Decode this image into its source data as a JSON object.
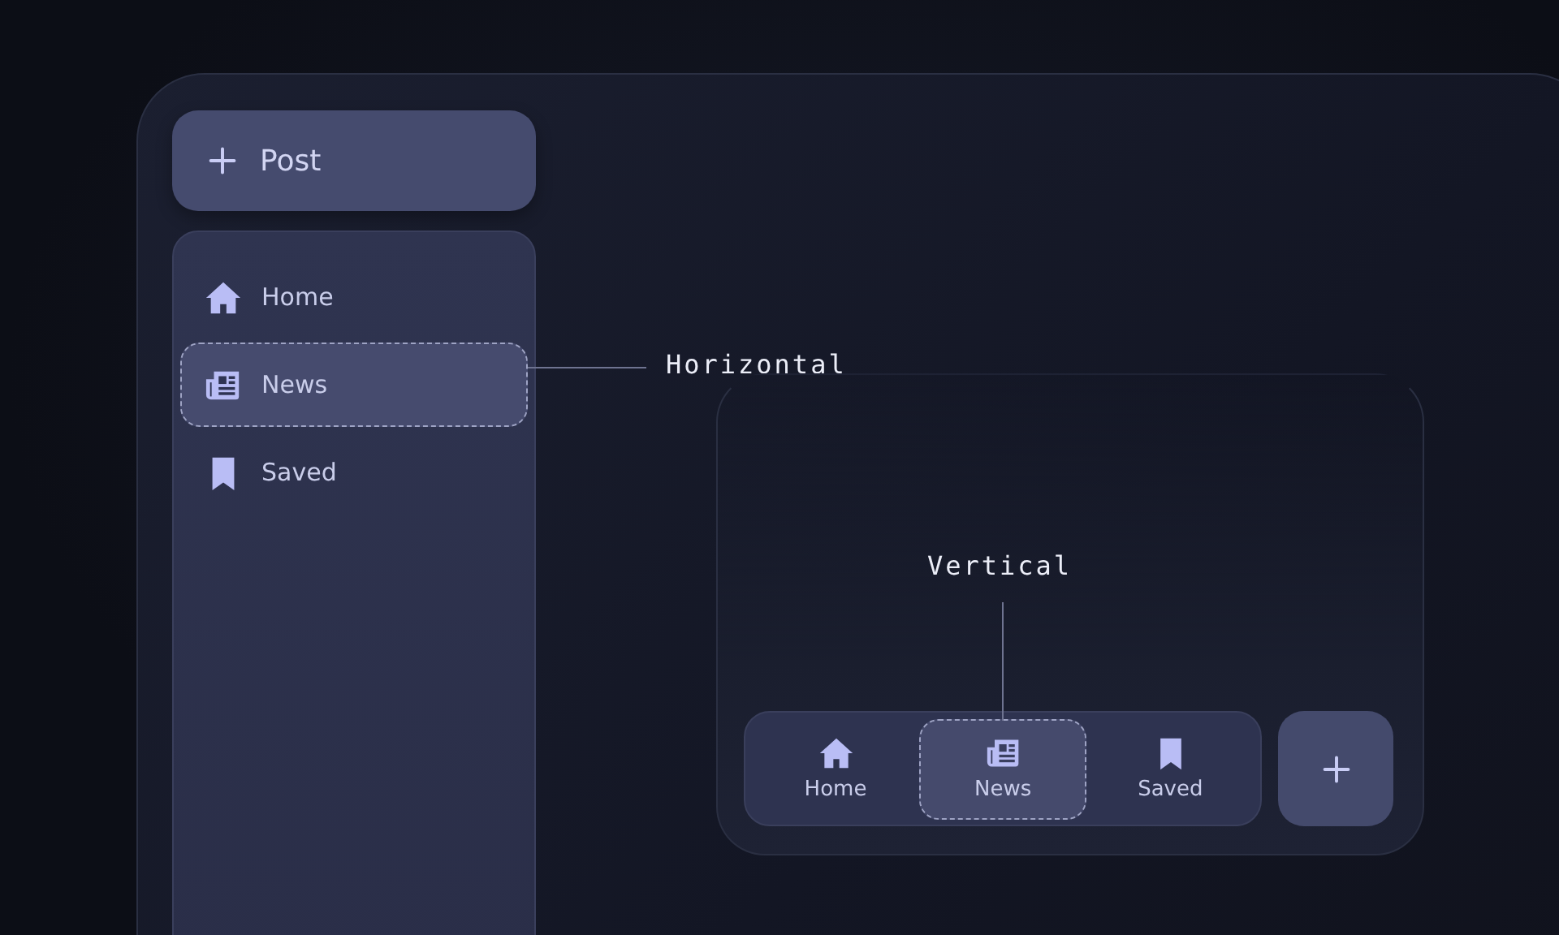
{
  "sidebar_layout": {
    "post_button": {
      "label": "Post"
    },
    "items": [
      {
        "label": "Home",
        "selected": false
      },
      {
        "label": "News",
        "selected": true
      },
      {
        "label": "Saved",
        "selected": false
      }
    ],
    "annotation": "Horizontal"
  },
  "bottom_layout": {
    "items": [
      {
        "label": "Home",
        "selected": false
      },
      {
        "label": "News",
        "selected": true
      },
      {
        "label": "Saved",
        "selected": false
      }
    ],
    "annotation": "Vertical"
  }
}
